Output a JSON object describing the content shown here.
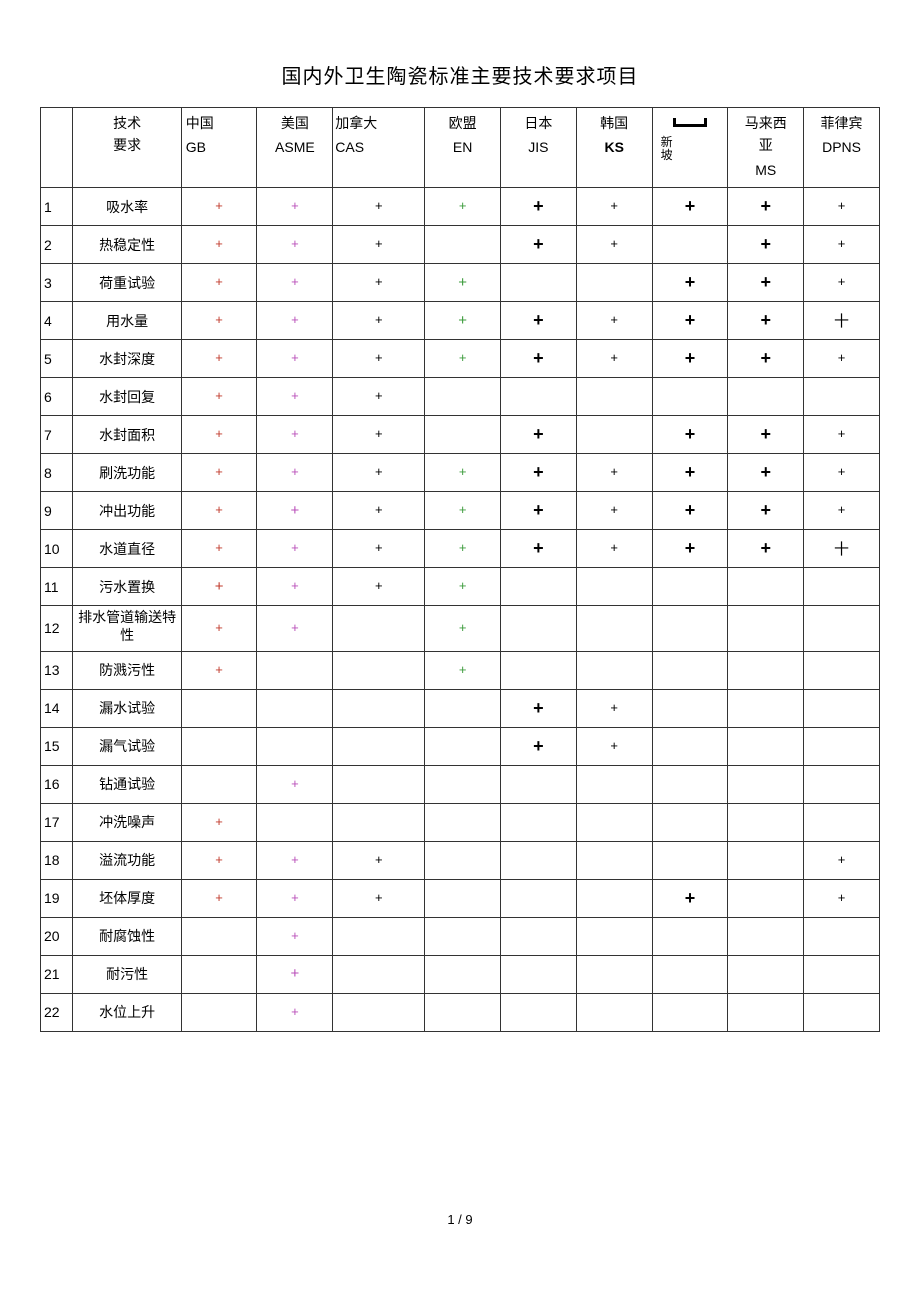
{
  "title": "国内外卫生陶瓷标准主要技术要求项目",
  "headers": {
    "req_top": "技术",
    "req_bot": "要求",
    "cn_top": "中国",
    "cn_bot": "GB",
    "us_top": "美国",
    "us_bot": "ASME",
    "ca_top": "加拿大",
    "ca_bot": "CAS",
    "eu_top": "欧盟",
    "eu_bot": "EN",
    "jp_top": "日本",
    "jp_bot": "JIS",
    "kr_top": "韩国",
    "kr_bot": "KS",
    "sg_top": "新",
    "sg_bot": "坡",
    "my_top": "马来西",
    "my_mid": "亚",
    "my_bot": "MS",
    "ph_top": "菲律宾",
    "ph_bot": "DPNS"
  },
  "footer": "1 / 9",
  "chart_data": {
    "type": "table",
    "title": "国内外卫生陶瓷标准主要技术要求项目",
    "columns": [
      "技术要求",
      "中国 GB",
      "美国 ASME",
      "加拿大 CAS",
      "欧盟 EN",
      "日本 JIS",
      "韩国 KS",
      "新坡",
      "马来西亚 MS",
      "菲律宾 DPNS"
    ],
    "rows": [
      {
        "idx": "1",
        "name": "吸水率",
        "cn": "+",
        "us": "+",
        "ca": "+",
        "eu": "+",
        "jp": "+",
        "kr": "+",
        "sg": "+",
        "my": "+",
        "ph": "+"
      },
      {
        "idx": "2",
        "name": "热稳定性",
        "cn": "+",
        "us": "+",
        "ca": "+",
        "eu": "",
        "jp": "+",
        "kr": "+",
        "sg": "",
        "my": "+",
        "ph": "+"
      },
      {
        "idx": "3",
        "name": "荷重试验",
        "cn": "+",
        "us": "+",
        "ca": "+",
        "eu": "+",
        "jp": "",
        "kr": "",
        "sg": "+",
        "my": "+",
        "ph": "+"
      },
      {
        "idx": "4",
        "name": "用水量",
        "cn": "+",
        "us": "+",
        "ca": "+",
        "eu": "+",
        "jp": "+",
        "kr": "+",
        "sg": "+",
        "my": "+",
        "ph": "十"
      },
      {
        "idx": "5",
        "name": "水封深度",
        "cn": "+",
        "us": "+",
        "ca": "+",
        "eu": "+",
        "jp": "+",
        "kr": "+",
        "sg": "+",
        "my": "+",
        "ph": "+"
      },
      {
        "idx": "6",
        "name": "水封回复",
        "cn": "+",
        "us": "+",
        "ca": "+",
        "eu": "",
        "jp": "",
        "kr": "",
        "sg": "",
        "my": "",
        "ph": ""
      },
      {
        "idx": "7",
        "name": "水封面积",
        "cn": "+",
        "us": "+",
        "ca": "+",
        "eu": "",
        "jp": "+",
        "kr": "",
        "sg": "+",
        "my": "+",
        "ph": "+"
      },
      {
        "idx": "8",
        "name": "刷洗功能",
        "cn": "+",
        "us": "+",
        "ca": "+",
        "eu": "+",
        "jp": "+",
        "kr": "+",
        "sg": "+",
        "my": "+",
        "ph": "+"
      },
      {
        "idx": "9",
        "name": "冲出功能",
        "cn": "+",
        "us": "+",
        "ca": "+",
        "eu": "+",
        "jp": "+",
        "kr": "+",
        "sg": "+",
        "my": "+",
        "ph": "+"
      },
      {
        "idx": "10",
        "name": "水道直径",
        "cn": "+",
        "us": "+",
        "ca": "+",
        "eu": "+",
        "jp": "+",
        "kr": "+",
        "sg": "+",
        "my": "+",
        "ph": "十"
      },
      {
        "idx": "11",
        "name": "污水置换",
        "cn": "+",
        "us": "+",
        "ca": "+",
        "eu": "+",
        "jp": "",
        "kr": "",
        "sg": "",
        "my": "",
        "ph": ""
      },
      {
        "idx": "12",
        "name": "排水管道输送特性",
        "cn": "+",
        "us": "+",
        "ca": "",
        "eu": "+",
        "jp": "",
        "kr": "",
        "sg": "",
        "my": "",
        "ph": ""
      },
      {
        "idx": "13",
        "name": "防溅污性",
        "cn": "+",
        "us": "",
        "ca": "",
        "eu": "+",
        "jp": "",
        "kr": "",
        "sg": "",
        "my": "",
        "ph": ""
      },
      {
        "idx": "14",
        "name": "漏水试验",
        "cn": "",
        "us": "",
        "ca": "",
        "eu": "",
        "jp": "+",
        "kr": "+",
        "sg": "",
        "my": "",
        "ph": ""
      },
      {
        "idx": "15",
        "name": "漏气试验",
        "cn": "",
        "us": "",
        "ca": "",
        "eu": "",
        "jp": "+",
        "kr": "+",
        "sg": "",
        "my": "",
        "ph": ""
      },
      {
        "idx": "16",
        "name": "钻通试验",
        "cn": "",
        "us": "+",
        "ca": "",
        "eu": "",
        "jp": "",
        "kr": "",
        "sg": "",
        "my": "",
        "ph": ""
      },
      {
        "idx": "17",
        "name": "冲洗噪声",
        "cn": "+",
        "us": "",
        "ca": "",
        "eu": "",
        "jp": "",
        "kr": "",
        "sg": "",
        "my": "",
        "ph": ""
      },
      {
        "idx": "18",
        "name": "溢流功能",
        "cn": "+",
        "us": "+",
        "ca": "+",
        "eu": "",
        "jp": "",
        "kr": "",
        "sg": "",
        "my": "",
        "ph": "+"
      },
      {
        "idx": "19",
        "name": "坯体厚度",
        "cn": "+",
        "us": "+",
        "ca": "+",
        "eu": "",
        "jp": "",
        "kr": "",
        "sg": "+",
        "my": "",
        "ph": "+"
      },
      {
        "idx": "20",
        "name": "耐腐蚀性",
        "cn": "",
        "us": "+",
        "ca": "",
        "eu": "",
        "jp": "",
        "kr": "",
        "sg": "",
        "my": "",
        "ph": ""
      },
      {
        "idx": "21",
        "name": "耐污性",
        "cn": "",
        "us": "+",
        "ca": "",
        "eu": "",
        "jp": "",
        "kr": "",
        "sg": "",
        "my": "",
        "ph": ""
      },
      {
        "idx": "22",
        "name": "水位上升",
        "cn": "",
        "us": "+",
        "ca": "",
        "eu": "",
        "jp": "",
        "kr": "",
        "sg": "",
        "my": "",
        "ph": ""
      }
    ]
  }
}
